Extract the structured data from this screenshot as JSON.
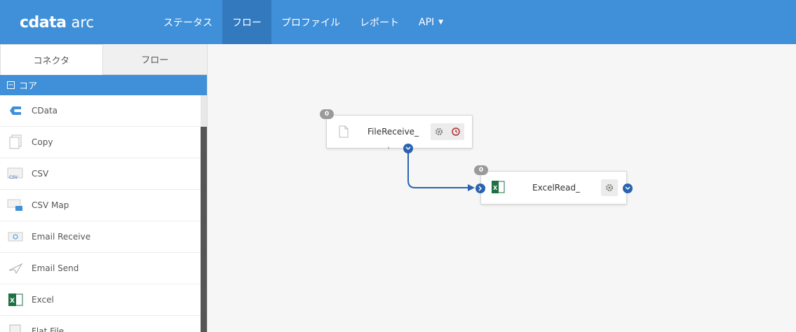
{
  "app": {
    "logo_mark": "cdata",
    "logo_sub": "arc"
  },
  "nav": {
    "items": [
      {
        "label": "ステータス",
        "active": false
      },
      {
        "label": "フロー",
        "active": true
      },
      {
        "label": "プロファイル",
        "active": false
      },
      {
        "label": "レポート",
        "active": false
      },
      {
        "label": "API",
        "active": false,
        "dropdown": true
      }
    ]
  },
  "sidebar": {
    "tabs": [
      {
        "label": "コネクタ",
        "active": true
      },
      {
        "label": "フロー",
        "active": false
      }
    ],
    "section": {
      "toggle": "−",
      "label": "コア"
    },
    "items": [
      {
        "label": "CData",
        "icon": "cdata-icon"
      },
      {
        "label": "Copy",
        "icon": "copy-icon"
      },
      {
        "label": "CSV",
        "icon": "csv-icon"
      },
      {
        "label": "CSV Map",
        "icon": "csv-map-icon"
      },
      {
        "label": "Email Receive",
        "icon": "email-receive-icon"
      },
      {
        "label": "Email Send",
        "icon": "email-send-icon"
      },
      {
        "label": "Excel",
        "icon": "excel-icon"
      },
      {
        "label": "Flat File",
        "icon": "flat-file-icon"
      }
    ]
  },
  "canvas": {
    "nodes": [
      {
        "label": "FileReceive_",
        "badge": "0",
        "icon": "file-icon"
      },
      {
        "label": "ExcelRead_",
        "badge": "0",
        "icon": "excel-icon"
      }
    ]
  },
  "colors": {
    "accent": "#3f8fd9",
    "port": "#2a63b0",
    "danger": "#b03030"
  }
}
